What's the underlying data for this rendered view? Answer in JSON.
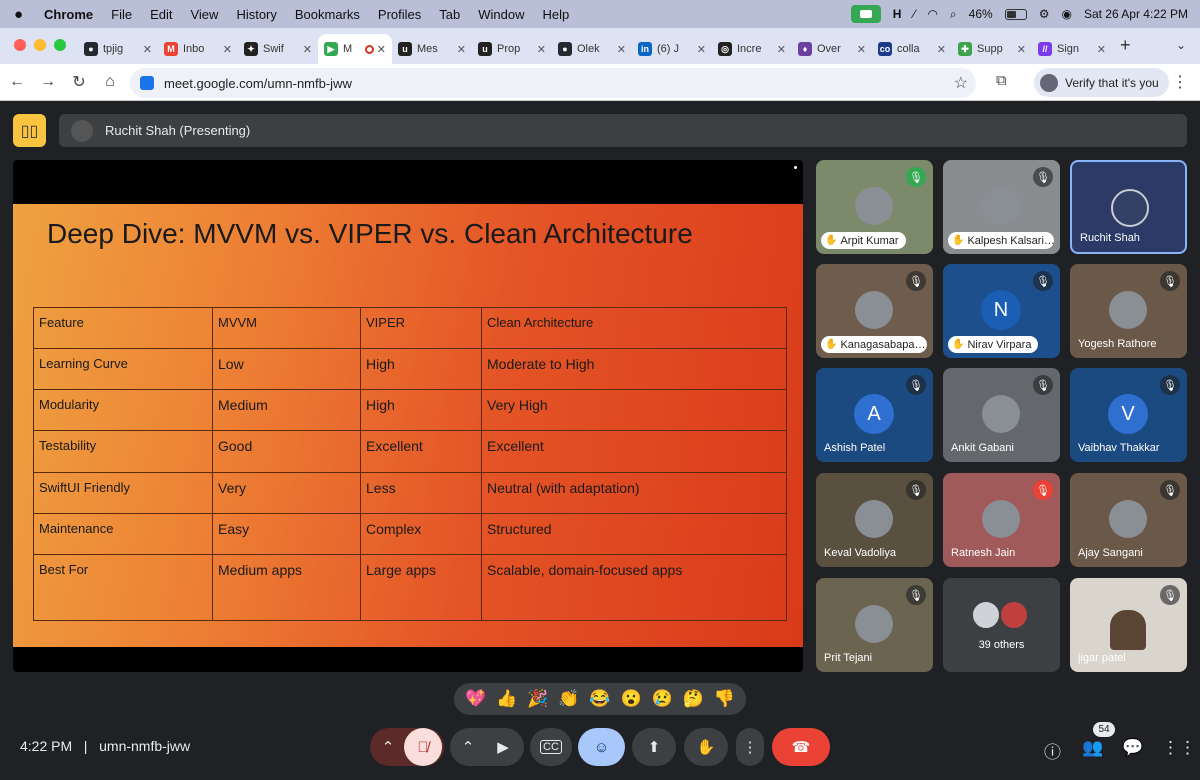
{
  "macbar": {
    "app": "Chrome",
    "menus": [
      "File",
      "Edit",
      "View",
      "History",
      "Bookmarks",
      "Profiles",
      "Tab",
      "Window",
      "Help"
    ],
    "battery": "46%",
    "datetime": "Sat 26 Apr  4:22 PM"
  },
  "tabs": [
    {
      "title": "tpjig",
      "color": "#24292f",
      "glyph": "●"
    },
    {
      "title": "Inbo",
      "color": "#ea4335",
      "glyph": "M"
    },
    {
      "title": "Swif",
      "color": "#222222",
      "glyph": "✦"
    },
    {
      "title": "M",
      "color": "#34a853",
      "glyph": "▶",
      "active": true
    },
    {
      "title": "Mes",
      "color": "#222222",
      "glyph": "u"
    },
    {
      "title": "Prop",
      "color": "#222222",
      "glyph": "u"
    },
    {
      "title": "Olek",
      "color": "#24292f",
      "glyph": "●"
    },
    {
      "title": "(6) J",
      "color": "#0a66c2",
      "glyph": "in"
    },
    {
      "title": "Incre",
      "color": "#222222",
      "glyph": "◎"
    },
    {
      "title": "Over",
      "color": "#6b3fa0",
      "glyph": "♦"
    },
    {
      "title": "colla",
      "color": "#1e3a8a",
      "glyph": "co"
    },
    {
      "title": "Supp",
      "color": "#3fa34d",
      "glyph": "✚"
    },
    {
      "title": "Sign",
      "color": "#7c3aed",
      "glyph": "//"
    }
  ],
  "address": {
    "url": "meet.google.com/umn-nmfb-jww",
    "verify": "Verify that it's you"
  },
  "meet": {
    "presenter": "Ruchit Shah (Presenting)",
    "meeting_code": "umn-nmfb-jww",
    "time": "4:22 PM",
    "participant_count": "54"
  },
  "slide": {
    "title": "Deep Dive: MVVM vs. VIPER vs. Clean Architecture",
    "header": [
      "Feature",
      "MVVM",
      "VIPER",
      "Clean Architecture"
    ],
    "rows": [
      [
        "Learning Curve",
        "Low",
        "High",
        "Moderate to High"
      ],
      [
        "Modularity",
        "Medium",
        "High",
        "Very High"
      ],
      [
        "Testability",
        "Good",
        "Excellent",
        "Excellent"
      ],
      [
        "SwiftUI Friendly",
        "Very",
        "Less",
        "Neutral (with adaptation)"
      ],
      [
        "Maintenance",
        "Easy",
        "Complex",
        "Structured"
      ],
      [
        "Best For",
        "Medium apps",
        "Large apps",
        "Scalable, domain-focused apps"
      ]
    ]
  },
  "participants": [
    {
      "name": "Arpit Kumar",
      "bg": "#7a8a6a",
      "style": "chip",
      "mic": "green"
    },
    {
      "name": "Kalpesh Kalsari…",
      "bg": "#8a8d8f",
      "style": "chip",
      "mic": "muted"
    },
    {
      "name": "Ruchit Shah",
      "bg": "#2b3a66",
      "style": "plain",
      "mic": "none",
      "active": true
    },
    {
      "name": "Kanagasabapa…",
      "bg": "#6e5d4c",
      "style": "chip",
      "mic": "muted"
    },
    {
      "name": "Nirav Virpara",
      "bg": "#1d4f8c",
      "style": "chip",
      "mic": "muted",
      "initial": "N",
      "initial_bg": "#1a5fb4"
    },
    {
      "name": "Yogesh Rathore",
      "bg": "#6a5848",
      "style": "plain",
      "mic": "muted"
    },
    {
      "name": "Ashish Patel",
      "bg": "#1a4a80",
      "style": "plain",
      "mic": "muted",
      "initial": "A",
      "initial_bg": "#2f6fcf"
    },
    {
      "name": "Ankit Gabani",
      "bg": "#64686c",
      "style": "plain",
      "mic": "muted"
    },
    {
      "name": "Vaibhav Thakkar",
      "bg": "#1a4a80",
      "style": "plain",
      "mic": "muted",
      "initial": "V",
      "initial_bg": "#2f6fcf"
    },
    {
      "name": "Keval Vadoliya",
      "bg": "#5a5040",
      "style": "plain",
      "mic": "muted"
    },
    {
      "name": "Ratnesh Jain",
      "bg": "#a05a5a",
      "style": "plain",
      "mic": "red"
    },
    {
      "name": "Ajay Sangani",
      "bg": "#6a5848",
      "style": "plain",
      "mic": "muted"
    },
    {
      "name": "Prit Tejani",
      "bg": "#6a6450",
      "style": "plain",
      "mic": "muted"
    },
    {
      "name": "39 others",
      "bg": "#3c4043",
      "style": "others",
      "mic": "none"
    },
    {
      "name": "jigar patel",
      "bg": "#d9d4cc",
      "style": "video",
      "mic": "muted"
    }
  ],
  "reactions": [
    "💖",
    "👍",
    "🎉",
    "👏",
    "😂",
    "😮",
    "😢",
    "🤔",
    "👎"
  ]
}
